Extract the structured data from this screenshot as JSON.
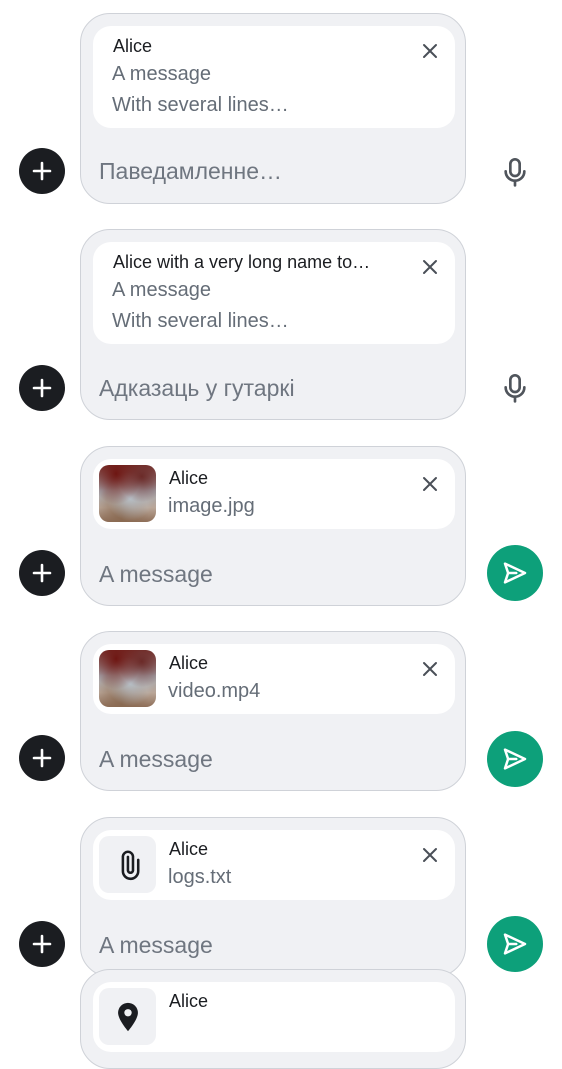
{
  "colors": {
    "add_button": "#1b1d21",
    "send_button": "#0da07a",
    "composer_background": "#f0f1f4",
    "reply_card_background": "#ffffff",
    "secondary_text": "#656d77"
  },
  "composers": [
    {
      "reply": {
        "sender": "Alice",
        "lines": [
          "A message",
          "With several lines…"
        ]
      },
      "placeholder": "Паведамленне…",
      "action": "mic-icon"
    },
    {
      "reply": {
        "sender": "Alice with a very long name to…",
        "lines": [
          "A message",
          "With several lines…"
        ]
      },
      "placeholder": "Адказаць у гутаркі",
      "action": "mic-icon"
    },
    {
      "reply": {
        "sender": "Alice",
        "attachment_name": "image.jpg",
        "thumbnail": "image-thumbnail"
      },
      "placeholder": "A message",
      "action": "send-icon"
    },
    {
      "reply": {
        "sender": "Alice",
        "attachment_name": "video.mp4",
        "thumbnail": "video-thumbnail"
      },
      "placeholder": "A message",
      "action": "send-icon"
    },
    {
      "reply": {
        "sender": "Alice",
        "attachment_name": "logs.txt",
        "thumbnail": "paperclip-icon"
      },
      "placeholder": "A message",
      "action": "send-icon"
    },
    {
      "reply": {
        "sender": "Alice",
        "thumbnail": "location-pin-icon"
      }
    }
  ]
}
